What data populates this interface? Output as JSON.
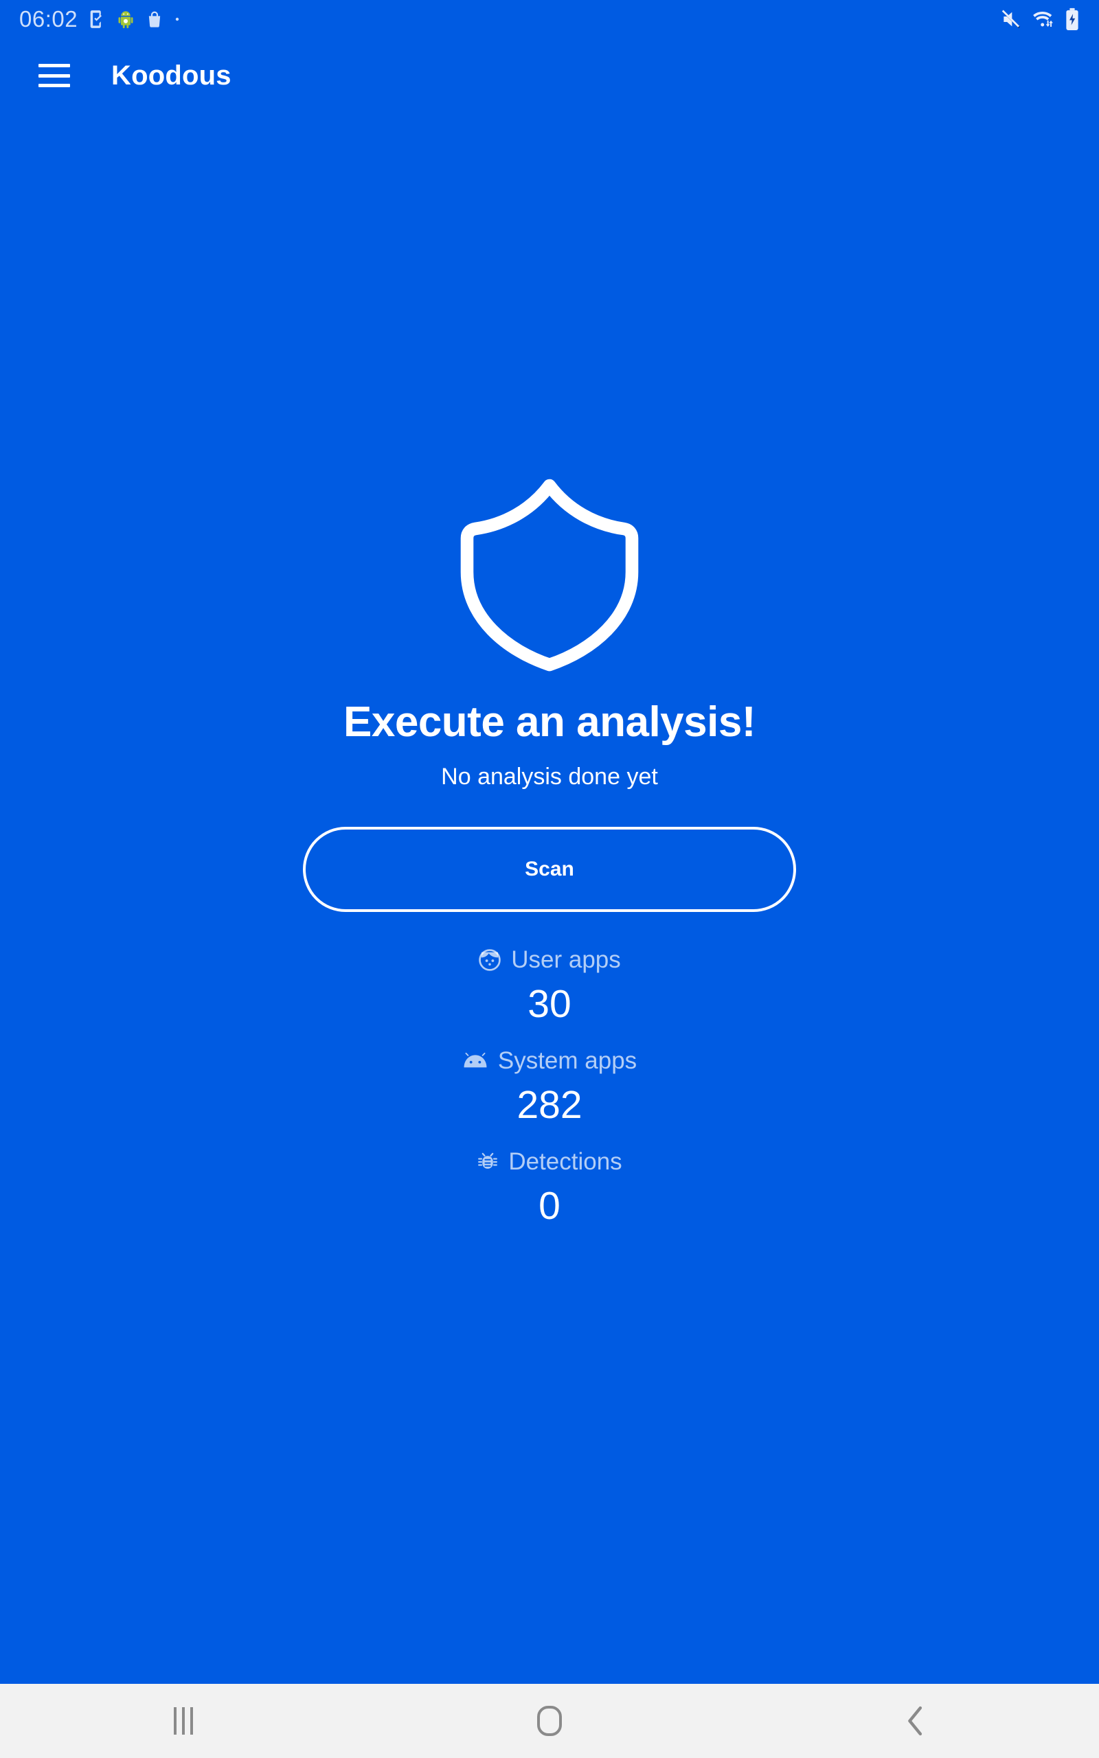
{
  "status_bar": {
    "clock": "06:02",
    "left_icons": [
      "phone-check-icon",
      "android-robot-icon",
      "shopping-bag-icon",
      "dot-icon"
    ],
    "right_icons": [
      "mute-icon",
      "wifi-icon",
      "battery-charging-icon"
    ]
  },
  "app_bar": {
    "menu_icon": "hamburger-menu-icon",
    "title": "Koodous"
  },
  "main": {
    "hero_icon": "shield-icon",
    "headline": "Execute an analysis!",
    "subhead": "No analysis done yet",
    "scan_label": "Scan",
    "stats": [
      {
        "icon": "face-icon",
        "label": "User apps",
        "value": "30"
      },
      {
        "icon": "android-head-icon",
        "label": "System apps",
        "value": "282"
      },
      {
        "icon": "bug-icon",
        "label": "Detections",
        "value": "0"
      }
    ]
  },
  "nav_bar": {
    "recents_label": "recents-icon",
    "home_label": "home-icon",
    "back_label": "back-icon"
  },
  "colors": {
    "background": "#005be2",
    "on_background": "#ffffff",
    "muted": "rgba(255,255,255,0.70)",
    "nav_bg": "#f2f2f2",
    "nav_icon": "#8a8a8a"
  }
}
